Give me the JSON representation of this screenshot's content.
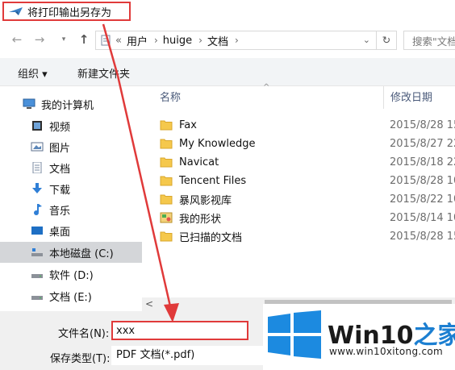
{
  "window": {
    "title": "将打印输出另存为"
  },
  "nav": {
    "back_icon": "back-arrow-icon",
    "forward_icon": "forward-arrow-icon",
    "up_icon": "up-arrow-icon",
    "breadcrumb": [
      "«",
      "用户",
      "huige",
      "文档"
    ],
    "search_placeholder": "搜索\"文档"
  },
  "toolbar": {
    "organize": "组织 ▾",
    "new_folder": "新建文件夹"
  },
  "sidebar": {
    "items": [
      {
        "label": "我的计算机",
        "icon": "computer-icon"
      },
      {
        "label": "视频",
        "icon": "video-icon"
      },
      {
        "label": "图片",
        "icon": "pictures-icon"
      },
      {
        "label": "文档",
        "icon": "documents-icon"
      },
      {
        "label": "下载",
        "icon": "download-icon"
      },
      {
        "label": "音乐",
        "icon": "music-icon"
      },
      {
        "label": "桌面",
        "icon": "desktop-icon"
      },
      {
        "label": "本地磁盘 (C:)",
        "icon": "drive-icon",
        "selected": true
      },
      {
        "label": "软件 (D:)",
        "icon": "drive-icon"
      },
      {
        "label": "文档 (E:)",
        "icon": "drive-icon"
      }
    ]
  },
  "filelist": {
    "headers": {
      "name": "名称",
      "date": "修改日期"
    },
    "rows": [
      {
        "name": "Fax",
        "date": "2015/8/28 15",
        "icon": "folder-icon"
      },
      {
        "name": "My Knowledge",
        "date": "2015/8/27 22",
        "icon": "folder-icon"
      },
      {
        "name": "Navicat",
        "date": "2015/8/18 22",
        "icon": "folder-icon"
      },
      {
        "name": "Tencent Files",
        "date": "2015/8/28 10",
        "icon": "folder-icon"
      },
      {
        "name": "暴风影视库",
        "date": "2015/8/22 10",
        "icon": "folder-icon"
      },
      {
        "name": "我的形状",
        "date": "2015/8/14 10",
        "icon": "shapes-folder-icon"
      },
      {
        "name": "已扫描的文档",
        "date": "2015/8/28 15",
        "icon": "folder-icon"
      }
    ]
  },
  "form": {
    "filename_label": "文件名(N):",
    "filename_value": "xxx",
    "filetype_label": "保存类型(T):",
    "filetype_value": "PDF 文档(*.pdf)"
  },
  "watermark": {
    "brand": "Win10",
    "brand_accent": "之家",
    "url": "www.win10xitong.com"
  },
  "colors": {
    "highlight_red": "#e03a3a",
    "accent_blue": "#1c7fd1",
    "selected_bg": "#d4d6d9"
  }
}
